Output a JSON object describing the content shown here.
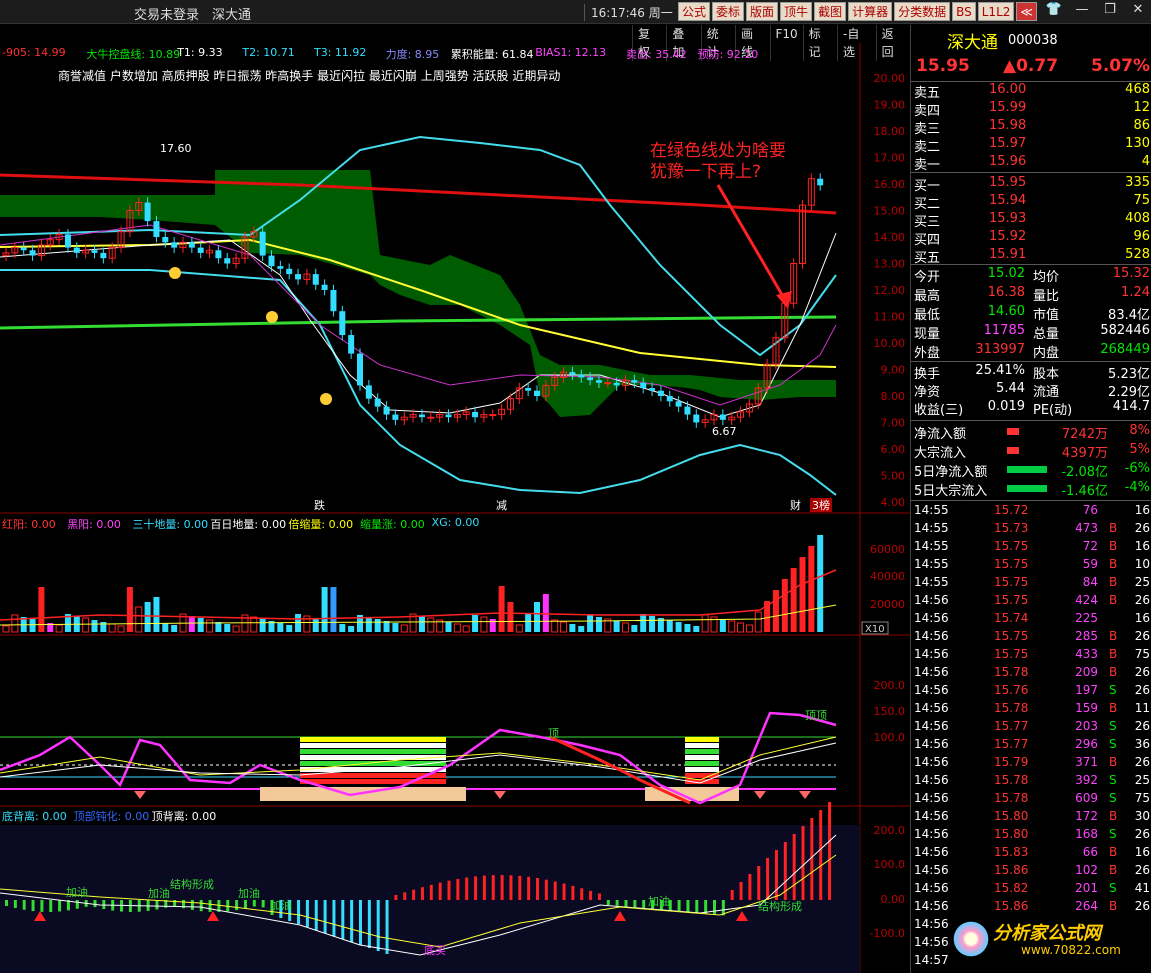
{
  "titlebar": {
    "login": "交易未登录",
    "stock": "深大通",
    "time": "16:17:46",
    "weekday": "周一",
    "buttons": [
      "公式",
      "委标",
      "版面",
      "顶牛",
      "截图",
      "计算器",
      "分类数据",
      "BS",
      "L1L2",
      "≪"
    ]
  },
  "toolbar": [
    "复权",
    "叠加",
    "统计",
    "画线",
    "F10",
    "标记",
    "-自选",
    "返回"
  ],
  "main_indicators": [
    {
      "text": "-905: 14.99",
      "color": "#ff3333"
    },
    {
      "text": "大牛控盘线: 10.89",
      "color": "#00e600"
    },
    {
      "text": "T1: 9.33",
      "color": "#ffffff"
    },
    {
      "text": "T2: 10.71",
      "color": "#33ddff"
    },
    {
      "text": "T3: 11.92",
      "color": "#33ddff"
    },
    {
      "text": "力度: 8.95",
      "color": "#8888ff"
    },
    {
      "text": "累积能量: 61.84",
      "color": "#ffffff"
    },
    {
      "text": "BIAS1: 12.13",
      "color": "#ff44ff"
    },
    {
      "text": "卖出: 35.42",
      "color": "#ff44ff"
    },
    {
      "text": "预防: 92.10",
      "color": "#ff44ff"
    }
  ],
  "headline": "商誉减值 户数增加 高质押股 昨日振荡 昨高换手 最近闪拉 最近闪崩 上周强势 活跃股 近期异动",
  "annotation": {
    "line1": "在绿色线处为啥要",
    "line2": "犹豫一下再上?"
  },
  "price_labels": {
    "high": "17.60",
    "low": "6.67"
  },
  "y_axis_main": [
    "20.00",
    "19.00",
    "18.00",
    "17.00",
    "16.00",
    "15.00",
    "14.00",
    "13.00",
    "12.00",
    "11.00",
    "10.00",
    "9.00",
    "8.00",
    "7.00",
    "6.00",
    "5.00",
    "4.00"
  ],
  "markers": {
    "die": "跌",
    "jian": "减",
    "cai": "财",
    "bang": "3榜"
  },
  "vol_indicators": [
    {
      "text": "红阳: 0.00",
      "color": "#ff3333"
    },
    {
      "text": "黑阳: 0.00",
      "color": "#ff44ff"
    },
    {
      "text": "三十地量: 0.00",
      "color": "#33ddff"
    },
    {
      "text": "百日地量: 0.00",
      "color": "#ffffff"
    },
    {
      "text": "倍缩量: 0.00",
      "color": "#ffff00"
    },
    {
      "text": "缩量涨: 0.00",
      "color": "#00e600"
    },
    {
      "text": "XG: 0.00",
      "color": "#33ddff"
    }
  ],
  "y_axis_vol": [
    "60000",
    "40000",
    "20000"
  ],
  "vol_unit": "X10",
  "y_axis_osc": [
    "200.0",
    "150.0",
    "100.0"
  ],
  "osc_labels": {
    "top": "顶",
    "top2": "顶顶"
  },
  "macd_indicators": [
    {
      "text": "底背离: 0.00",
      "color": "#33ddff"
    },
    {
      "text": "顶部钝化: 0.00",
      "color": "#3366ff"
    },
    {
      "text": "顶背离: 0.00",
      "color": "#ffffff"
    }
  ],
  "y_axis_macd": [
    "200.0",
    "100.0",
    "0.00",
    "-100.0"
  ],
  "macd_labels": [
    "加油",
    "加油",
    "结构形成",
    "加油",
    "加油",
    "底买",
    "加油",
    "结构形成"
  ],
  "quote": {
    "name": "深大通",
    "code": "000038",
    "price": "15.95",
    "change": "▲0.77",
    "pct": "5.07%",
    "asks": [
      {
        "label": "卖五",
        "price": "16.00",
        "vol": "468"
      },
      {
        "label": "卖四",
        "price": "15.99",
        "vol": "12"
      },
      {
        "label": "卖三",
        "price": "15.98",
        "vol": "86"
      },
      {
        "label": "卖二",
        "price": "15.97",
        "vol": "130"
      },
      {
        "label": "卖一",
        "price": "15.96",
        "vol": "4"
      }
    ],
    "bids": [
      {
        "label": "买一",
        "price": "15.95",
        "vol": "335"
      },
      {
        "label": "买二",
        "price": "15.94",
        "vol": "75"
      },
      {
        "label": "买三",
        "price": "15.93",
        "vol": "408"
      },
      {
        "label": "买四",
        "price": "15.92",
        "vol": "96"
      },
      {
        "label": "买五",
        "price": "15.91",
        "vol": "528"
      }
    ],
    "stats": [
      {
        "l1": "今开",
        "v1": "15.02",
        "c1": "green",
        "l2": "均价",
        "v2": "15.32",
        "c2": "red"
      },
      {
        "l1": "最高",
        "v1": "16.38",
        "c1": "red",
        "l2": "量比",
        "v2": "1.24",
        "c2": "red"
      },
      {
        "l1": "最低",
        "v1": "14.60",
        "c1": "green",
        "l2": "市值",
        "v2": "83.4亿",
        "c2": "white"
      },
      {
        "l1": "现量",
        "v1": "11785",
        "c1": "mag",
        "l2": "总量",
        "v2": "582446",
        "c2": "white"
      },
      {
        "l1": "外盘",
        "v1": "313997",
        "c1": "red",
        "l2": "内盘",
        "v2": "268449",
        "c2": "green"
      }
    ],
    "stats2": [
      {
        "l1": "换手",
        "v1": "25.41%",
        "l2": "股本",
        "v2": "5.23亿"
      },
      {
        "l1": "净资",
        "v1": "5.44",
        "l2": "流通",
        "v2": "2.29亿"
      },
      {
        "l1": "收益(三)",
        "v1": "0.019",
        "l2": "PE(动)",
        "v2": "414.7"
      }
    ],
    "flows": [
      {
        "label": "净流入额",
        "value": "7242万",
        "pct": "8%",
        "color": "red"
      },
      {
        "label": "大宗流入",
        "value": "4397万",
        "pct": "5%",
        "color": "red"
      },
      {
        "label": "5日净流入额",
        "value": "-2.08亿",
        "pct": "-6%",
        "color": "green"
      },
      {
        "label": "5日大宗流入",
        "value": "-1.46亿",
        "pct": "-4%",
        "color": "green"
      }
    ],
    "ticks": [
      {
        "t": "14:55",
        "p": "15.72",
        "v": "76",
        "bs": "",
        "n": "16",
        "c": "mag"
      },
      {
        "t": "14:55",
        "p": "15.73",
        "v": "473",
        "bs": "B",
        "n": "26",
        "c": "mag"
      },
      {
        "t": "14:55",
        "p": "15.75",
        "v": "72",
        "bs": "B",
        "n": "16",
        "c": "mag"
      },
      {
        "t": "14:55",
        "p": "15.75",
        "v": "59",
        "bs": "B",
        "n": "10",
        "c": "mag"
      },
      {
        "t": "14:55",
        "p": "15.75",
        "v": "84",
        "bs": "B",
        "n": "25",
        "c": "mag"
      },
      {
        "t": "14:56",
        "p": "15.75",
        "v": "424",
        "bs": "B",
        "n": "26",
        "c": "mag"
      },
      {
        "t": "14:56",
        "p": "15.74",
        "v": "225",
        "bs": "",
        "n": "16",
        "c": "mag"
      },
      {
        "t": "14:56",
        "p": "15.75",
        "v": "285",
        "bs": "B",
        "n": "26",
        "c": "mag"
      },
      {
        "t": "14:56",
        "p": "15.75",
        "v": "433",
        "bs": "B",
        "n": "75",
        "c": "mag"
      },
      {
        "t": "14:56",
        "p": "15.78",
        "v": "209",
        "bs": "B",
        "n": "26",
        "c": "mag"
      },
      {
        "t": "14:56",
        "p": "15.76",
        "v": "197",
        "bs": "S",
        "n": "26",
        "c": "mag"
      },
      {
        "t": "14:56",
        "p": "15.78",
        "v": "159",
        "bs": "B",
        "n": "11",
        "c": "mag"
      },
      {
        "t": "14:56",
        "p": "15.77",
        "v": "203",
        "bs": "S",
        "n": "26",
        "c": "mag"
      },
      {
        "t": "14:56",
        "p": "15.77",
        "v": "296",
        "bs": "S",
        "n": "36",
        "c": "mag"
      },
      {
        "t": "14:56",
        "p": "15.79",
        "v": "371",
        "bs": "B",
        "n": "26",
        "c": "mag"
      },
      {
        "t": "14:56",
        "p": "15.78",
        "v": "392",
        "bs": "S",
        "n": "25",
        "c": "mag"
      },
      {
        "t": "14:56",
        "p": "15.78",
        "v": "609",
        "bs": "S",
        "n": "75",
        "c": "mag"
      },
      {
        "t": "14:56",
        "p": "15.80",
        "v": "172",
        "bs": "B",
        "n": "30",
        "c": "mag"
      },
      {
        "t": "14:56",
        "p": "15.80",
        "v": "168",
        "bs": "S",
        "n": "26",
        "c": "mag"
      },
      {
        "t": "14:56",
        "p": "15.83",
        "v": "66",
        "bs": "B",
        "n": "16",
        "c": "mag"
      },
      {
        "t": "14:56",
        "p": "15.86",
        "v": "102",
        "bs": "B",
        "n": "26",
        "c": "mag"
      },
      {
        "t": "14:56",
        "p": "15.82",
        "v": "201",
        "bs": "S",
        "n": "41",
        "c": "mag"
      },
      {
        "t": "14:56",
        "p": "15.86",
        "v": "264",
        "bs": "B",
        "n": "26",
        "c": "mag"
      },
      {
        "t": "14:56",
        "p": "",
        "v": "",
        "bs": "",
        "n": "",
        "c": "mag"
      },
      {
        "t": "14:56",
        "p": "",
        "v": "",
        "bs": "",
        "n": "",
        "c": "mag"
      },
      {
        "t": "14:57",
        "p": "",
        "v": "",
        "bs": "",
        "n": "",
        "c": "mag"
      }
    ]
  },
  "watermark": {
    "text": "分析家公式网",
    "url": "www.70822.com"
  }
}
